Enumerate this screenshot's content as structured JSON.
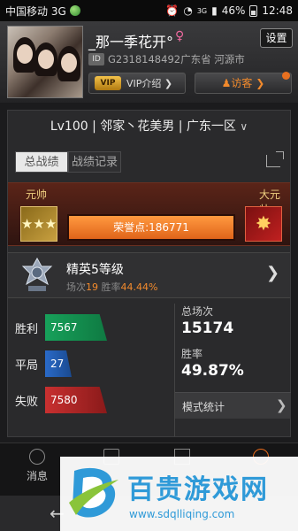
{
  "status_bar": {
    "carrier": "中国移动 3G",
    "battery_percent": "46%",
    "time": "12:48",
    "signal_label": "3G"
  },
  "profile": {
    "username": "_那一季花开°",
    "id_badge": "ID",
    "id_text": "G2318148492广东省 河源市",
    "settings_label": "设置",
    "vip_logo": "VIP",
    "vip_label": "VIP介绍 ❯",
    "visitor_label": "♟访客 ❯",
    "avatar_icon": "user-photo",
    "gender_icon": "female-icon"
  },
  "panel": {
    "level_line": "Lv100 | 邻家丶花美男 | 广东一区",
    "tabs": [
      {
        "label": "总战绩",
        "active": true
      },
      {
        "label": "战绩记录",
        "active": false
      }
    ],
    "honor": {
      "left_rank": "元帅",
      "right_rank": "大元帅",
      "points_label": "荣誉点:186771",
      "left_badge": "★★★",
      "right_badge": "✸"
    },
    "tier": {
      "name": "精英5等级",
      "matches_label": "场次",
      "matches_value": "19",
      "winrate_label": "胜率",
      "winrate_value": "44.44%"
    },
    "results": {
      "win_label": "胜利",
      "win_value": "7567",
      "draw_label": "平局",
      "draw_value": "27",
      "loss_label": "失败",
      "loss_value": "7580",
      "total_label": "总场次",
      "total_value": "15174",
      "rate_label": "胜率",
      "rate_value": "49.87%",
      "mode_label": "模式统计"
    }
  },
  "bottom_nav": {
    "items": [
      {
        "label": "消息",
        "icon": "message-icon"
      },
      {
        "label": "",
        "icon": "book-icon"
      },
      {
        "label": "",
        "icon": "flag-icon"
      },
      {
        "label": "",
        "icon": "person-icon"
      }
    ]
  },
  "watermark": {
    "title": "百贵游戏网",
    "url": "www.sdqlliqing.com"
  },
  "colors": {
    "accent": "#f28a2c",
    "win": "#17a05a",
    "draw": "#2a6ac8",
    "loss": "#c83030",
    "watermark": "#2f9ad8"
  }
}
